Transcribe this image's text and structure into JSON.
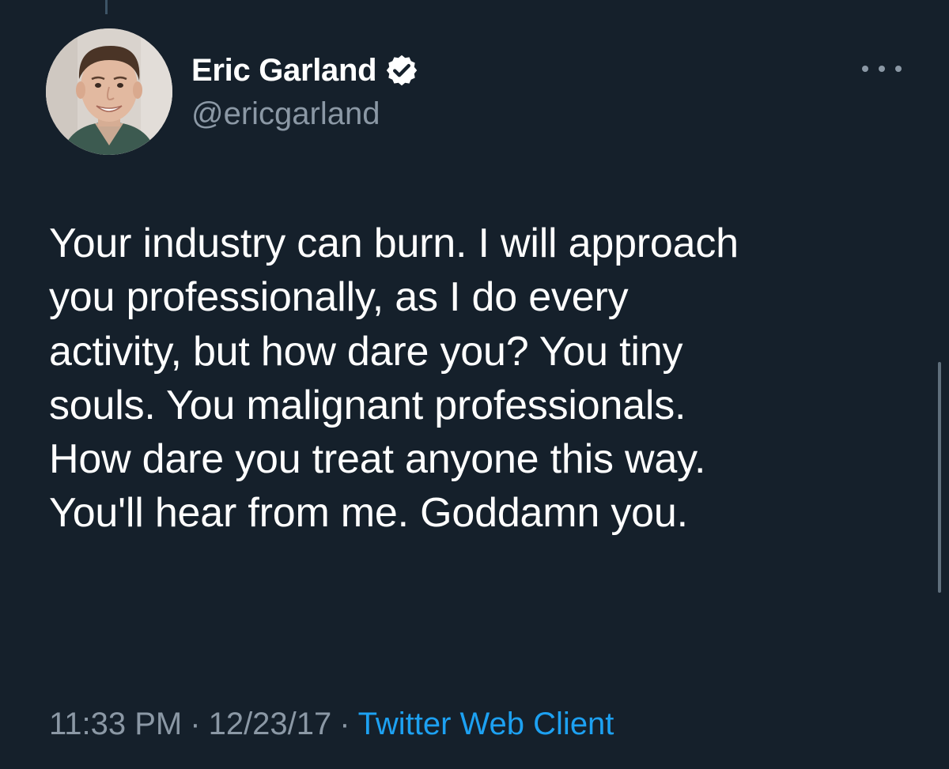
{
  "tweet": {
    "author": {
      "display_name": "Eric Garland",
      "handle": "@ericgarland",
      "verified": true,
      "avatar_icon": "user-avatar-photo"
    },
    "text_lines": [
      "Your industry can burn. I will approach",
      "you professionally, as I do every",
      "activity, but how dare you? You tiny",
      "souls. You malignant professionals.",
      "How dare you treat anyone this way.",
      "You'll hear from me. Goddamn you."
    ],
    "time": "11:33 PM",
    "separator": "·",
    "date": "12/23/17",
    "source": "Twitter Web Client",
    "more_icon": "more-horizontal-icon"
  },
  "colors": {
    "background": "#15202b",
    "text_primary": "#ffffff",
    "text_secondary": "#8b98a5",
    "link": "#1da1f2"
  }
}
